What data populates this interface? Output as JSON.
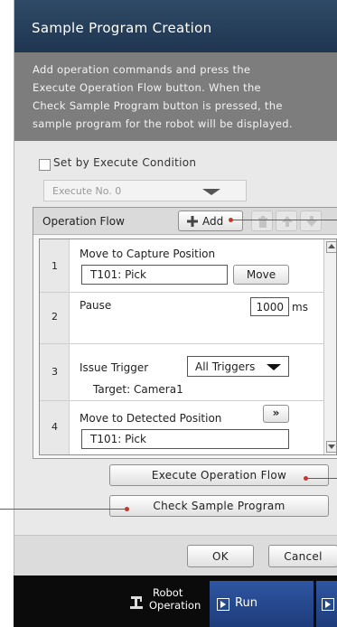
{
  "dialog": {
    "title": "Sample Program Creation",
    "description_lines": [
      "Add operation commands and press the",
      "Execute Operation Flow button. When the",
      "Check Sample Program button is pressed, the",
      "sample program for the robot will be displayed."
    ]
  },
  "condition": {
    "checkbox_label": "Set by Execute Condition",
    "checked": false,
    "execute_select_value": "Execute No. 0"
  },
  "flow": {
    "header": "Operation Flow",
    "add_label": "Add",
    "rows": [
      {
        "num": "1",
        "title": "Move to Capture Position",
        "field": "T101: Pick",
        "button": "Move"
      },
      {
        "num": "2",
        "title": "Pause",
        "value": "1000",
        "unit": "ms"
      },
      {
        "num": "3",
        "title": "Issue Trigger",
        "select": "All Triggers",
        "target": "Target: Camera1"
      },
      {
        "num": "4",
        "title": "Move to Detected Position",
        "field": "T101: Pick",
        "expand": "»"
      }
    ]
  },
  "actions": {
    "execute_label": "Execute Operation Flow",
    "check_label": "Check Sample Program",
    "ok_label": "OK",
    "cancel_label": "Cancel"
  },
  "taskbar": {
    "robot_line1": "Robot",
    "robot_line2": "Operation",
    "run_label": "Run"
  },
  "colors": {
    "title_bg": "#1f3550",
    "desc_bg": "#7d7d7d",
    "run_bg": "#2e56a3",
    "leader_line": "#c0392b"
  }
}
